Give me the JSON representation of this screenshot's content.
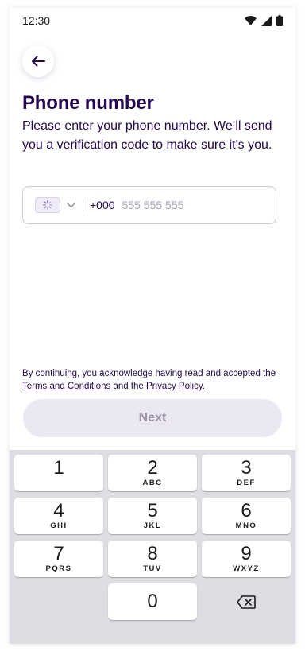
{
  "status_bar": {
    "time": "12:30",
    "icons": [
      "wifi-icon",
      "signal-icon",
      "battery-icon"
    ]
  },
  "header": {
    "back_icon": "arrow-left-icon",
    "title": "Phone number",
    "subtitle": "Please enter your phone number. We’ll send you a verification code to make sure it's you."
  },
  "phone_field": {
    "country_icon": "loading-spinner-icon",
    "dropdown_icon": "chevron-down-icon",
    "dial_code": "+000",
    "value": "",
    "placeholder": "555 555 555"
  },
  "legal": {
    "prefix": "By continuing, you acknowledge having read and accepted the",
    "terms_link": "Terms and Conditions",
    "middle": "and the",
    "privacy_link": "Privacy Policy."
  },
  "next_button": {
    "label": "Next",
    "enabled": false
  },
  "keypad": {
    "keys": [
      {
        "num": "1",
        "letters": ""
      },
      {
        "num": "2",
        "letters": "ABC"
      },
      {
        "num": "3",
        "letters": "DEF"
      },
      {
        "num": "4",
        "letters": "GHI"
      },
      {
        "num": "5",
        "letters": "JKL"
      },
      {
        "num": "6",
        "letters": "MNO"
      },
      {
        "num": "7",
        "letters": "PQRS"
      },
      {
        "num": "8",
        "letters": "TUV"
      },
      {
        "num": "9",
        "letters": "WXYZ"
      },
      {
        "num": "0",
        "letters": ""
      }
    ],
    "backspace_icon": "backspace-icon"
  },
  "colors": {
    "primary_text": "#24074d",
    "disabled_button_bg": "#ece8f2",
    "disabled_button_text": "#9c94a9",
    "keypad_bg": "#dfdde3"
  }
}
